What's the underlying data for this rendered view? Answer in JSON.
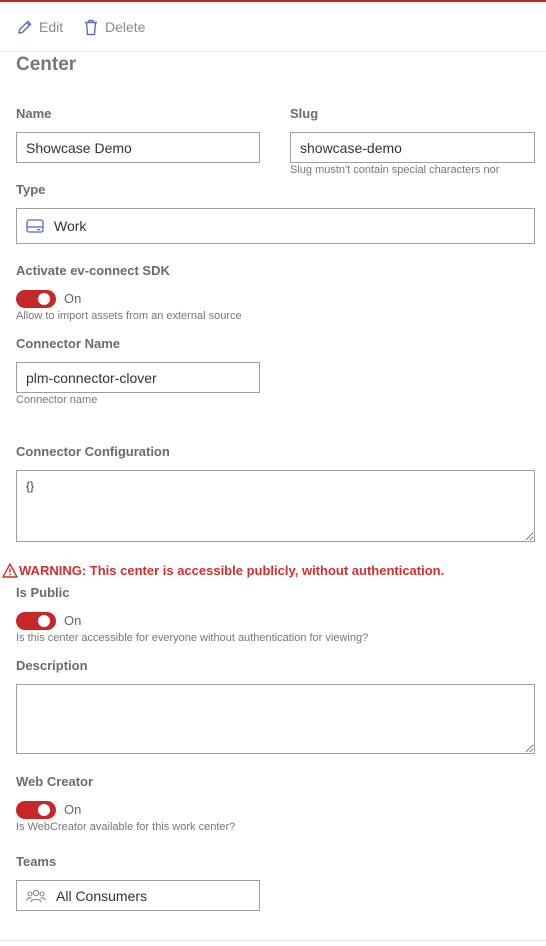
{
  "toolbar": {
    "edit_label": "Edit",
    "delete_label": "Delete"
  },
  "page": {
    "title": "Center"
  },
  "form": {
    "name": {
      "label": "Name",
      "value": "Showcase Demo"
    },
    "slug": {
      "label": "Slug",
      "value": "showcase-demo",
      "hint": "Slug mustn't contain special characters nor"
    },
    "type": {
      "label": "Type",
      "value": "Work",
      "icon": "hard-drive-icon"
    },
    "sdk": {
      "label": "Activate ev-connect SDK",
      "state": "On",
      "hint": "Allow to import assets from an external source"
    },
    "connector_name": {
      "label": "Connector Name",
      "value": "plm-connector-clover",
      "hint": "Connector name"
    },
    "connector_config": {
      "label": "Connector Configuration",
      "value": "{}"
    },
    "warning": "WARNING: This center is accessible publicly, without authentication.",
    "is_public": {
      "label": "Is Public",
      "state": "On",
      "hint": "Is this center accessible for everyone without authentication for viewing?"
    },
    "description": {
      "label": "Description",
      "value": ""
    },
    "web_creator": {
      "label": "Web Creator",
      "state": "On",
      "hint": "Is WebCreator available for this work center?"
    },
    "teams": {
      "label": "Teams",
      "value": "All Consumers",
      "icon": "users-icon"
    }
  },
  "colors": {
    "accent": "#c62828",
    "warning": "#d32f2f"
  }
}
